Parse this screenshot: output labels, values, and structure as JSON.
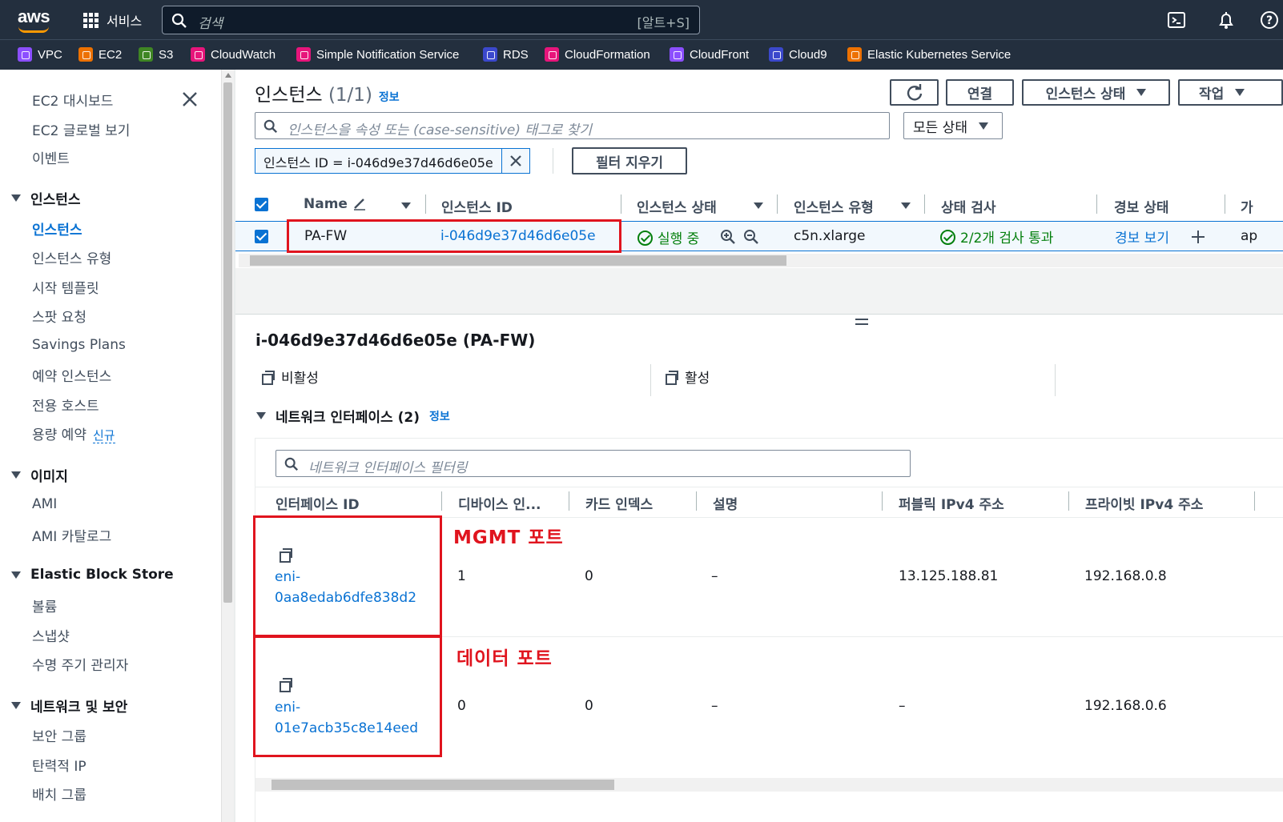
{
  "topbar": {
    "logo": "aws",
    "services_label": "서비스",
    "search_placeholder": "검색",
    "search_shortcut": "[알트+S]",
    "icons": [
      "cloudshell-icon",
      "bell-icon",
      "help-icon"
    ]
  },
  "favorites": [
    {
      "label": "VPC",
      "color": "#8c4fff"
    },
    {
      "label": "EC2",
      "color": "#ed7100"
    },
    {
      "label": "S3",
      "color": "#3f8624"
    },
    {
      "label": "CloudWatch",
      "color": "#e7157b"
    },
    {
      "label": "Simple Notification Service",
      "color": "#e7157b"
    },
    {
      "label": "RDS",
      "color": "#3b48cc"
    },
    {
      "label": "CloudFormation",
      "color": "#e7157b"
    },
    {
      "label": "CloudFront",
      "color": "#8c4fff"
    },
    {
      "label": "Cloud9",
      "color": "#3b48cc"
    },
    {
      "label": "Elastic Kubernetes Service",
      "color": "#ed7100"
    }
  ],
  "sidebar": {
    "top": [
      "EC2 대시보드",
      "EC2 글로벌 보기",
      "이벤트"
    ],
    "sections": [
      {
        "title": "인스턴스",
        "items": [
          "인스턴스",
          "인스턴스 유형",
          "시작 템플릿",
          "스팟 요청",
          "Savings Plans",
          "예약 인스턴스",
          "전용 호스트",
          "용량 예약"
        ],
        "new_badge": "신규"
      },
      {
        "title": "이미지",
        "items": [
          "AMI",
          "AMI 카탈로그"
        ]
      },
      {
        "title": "Elastic Block Store",
        "items": [
          "볼륨",
          "스냅샷",
          "수명 주기 관리자"
        ]
      },
      {
        "title": "네트워크 및 보안",
        "items": [
          "보안 그룹",
          "탄력적 IP",
          "배치 그룹"
        ]
      }
    ]
  },
  "main": {
    "title": "인스턴스",
    "count": "(1/1)",
    "info": "정보",
    "buttons": {
      "connect": "연결",
      "instance_state": "인스턴스 상태",
      "actions": "작업"
    },
    "search_placeholder": "인스턴스을 속성 또는 (case-sensitive) 태그로 찾기",
    "state_filter": "모든 상태",
    "filter_token": "인스턴스 ID = i-046d9e37d46d6e05e",
    "clear_filters": "필터 지우기",
    "columns": [
      "Name",
      "인스턴스 ID",
      "인스턴스 상태",
      "인스턴스 유형",
      "상태 검사",
      "경보 상태",
      "가"
    ],
    "row": {
      "name": "PA-FW",
      "instance_id": "i-046d9e37d46d6e05e",
      "state": "실행 중",
      "type": "c5n.xlarge",
      "status_check": "2/2개 검사 통과",
      "alarm": "경보 보기",
      "az": "ap"
    }
  },
  "detail": {
    "title": "i-046d9e37d46d6e05e (PA-FW)",
    "copy_left": "비활성",
    "copy_right": "활성",
    "ni_title": "네트워크 인터페이스 (2)",
    "ni_info": "정보",
    "ni_filter_placeholder": "네트워크 인터페이스 필터링",
    "ni_columns": [
      "인터페이스 ID",
      "디바이스 인...",
      "카드 인덱스",
      "설명",
      "퍼블릭 IPv4 주소",
      "프라이빗 IPv4 주소"
    ],
    "ni_rows": [
      {
        "id_a": "eni-",
        "id_b": "0aa8edab6dfe838d2",
        "device": "1",
        "card": "0",
        "desc": "–",
        "public": "13.125.188.81",
        "private": "192.168.0.8",
        "annotation": "MGMT 포트"
      },
      {
        "id_a": "eni-",
        "id_b": "01e7acb35c8e14eed",
        "device": "0",
        "card": "0",
        "desc": "–",
        "public": "–",
        "private": "192.168.0.6",
        "annotation": "데이터 포트"
      }
    ]
  }
}
